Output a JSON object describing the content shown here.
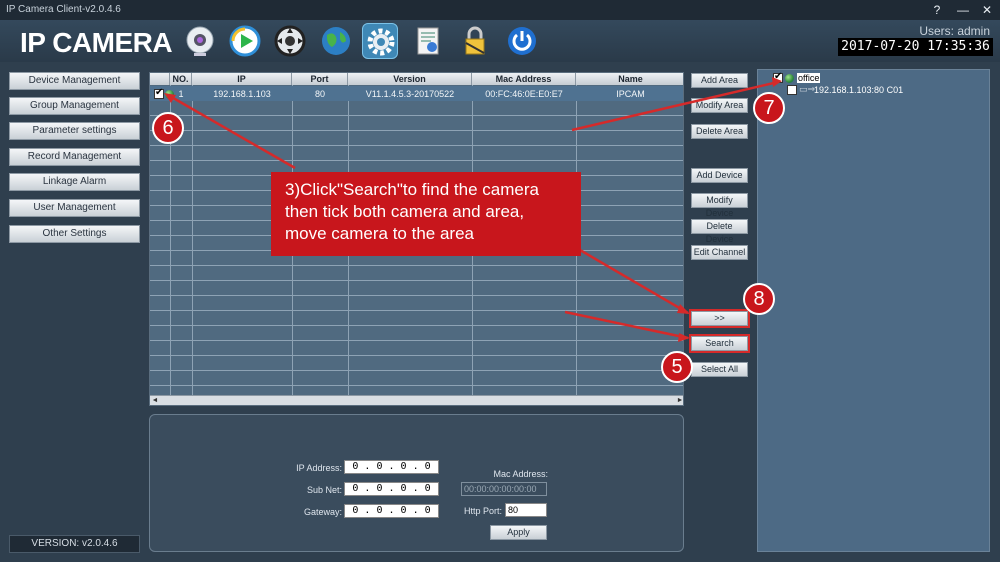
{
  "window": {
    "title": "IP Camera Client-v2.0.4.6",
    "help_glyph": "?",
    "min_glyph": "—",
    "close_glyph": "✕"
  },
  "header": {
    "logo": "IP CAMERA",
    "users": "Users: admin",
    "clock": "2017-07-20 17:35:36",
    "toolbar": [
      {
        "icon": "webcam-icon"
      },
      {
        "icon": "playback-icon"
      },
      {
        "icon": "ptz-control-icon"
      },
      {
        "icon": "globe-icon"
      },
      {
        "icon": "gear-icon",
        "active": true
      },
      {
        "icon": "document-icon"
      },
      {
        "icon": "lock-icon"
      },
      {
        "icon": "power-icon"
      }
    ]
  },
  "sidebar": {
    "items": [
      {
        "label": "Device Management"
      },
      {
        "label": "Group Management"
      },
      {
        "label": "Parameter settings"
      },
      {
        "label": "Record Management"
      },
      {
        "label": "Linkage Alarm"
      },
      {
        "label": "User Management"
      },
      {
        "label": "Other Settings"
      }
    ],
    "version": "VERSION: v2.0.4.6"
  },
  "device_table": {
    "columns": [
      "NO.",
      "IP",
      "Port",
      "Version",
      "Mac Address",
      "Name"
    ],
    "rows": [
      {
        "no": "1",
        "ip": "192.168.1.103",
        "port": "80",
        "version": "V11.1.4.5.3-20170522",
        "mac": "00:FC:46:0E:E0:E7",
        "name": "IPCAM",
        "checked": true
      }
    ],
    "scroll_left": "◄",
    "scroll_right": "►"
  },
  "actions": {
    "add_area": "Add Area",
    "modify_area": "Modify Area",
    "delete_area": "Delete Area",
    "add_device": "Add Device",
    "modify_device": "Modify Device",
    "delete_device": "Delete Device",
    "edit_channel": "Edit Channel",
    "move": ">>",
    "search": "Search",
    "select_all": "Select All"
  },
  "area_tree": {
    "root": "office",
    "child": "192.168.1.103:80 C01"
  },
  "detail": {
    "ip_label": "IP Address:",
    "ip_value": "0 . 0 . 0 . 0",
    "subnet_label": "Sub Net:",
    "subnet_value": "0 . 0 . 0 . 0",
    "gateway_label": "Gateway:",
    "gateway_value": "0 . 0 . 0 . 0",
    "mac_label": "Mac Address:",
    "mac_value": "00:00:00:00:00:00",
    "http_label": "Http Port:",
    "http_value": "80",
    "apply": "Apply"
  },
  "annotation": {
    "line1": "3)Click\"Search\"to find the camera",
    "line2": "then tick both camera and area,",
    "line3": "move camera to the area",
    "badges": [
      "5",
      "6",
      "7",
      "8"
    ],
    "color": "#c8161c"
  }
}
